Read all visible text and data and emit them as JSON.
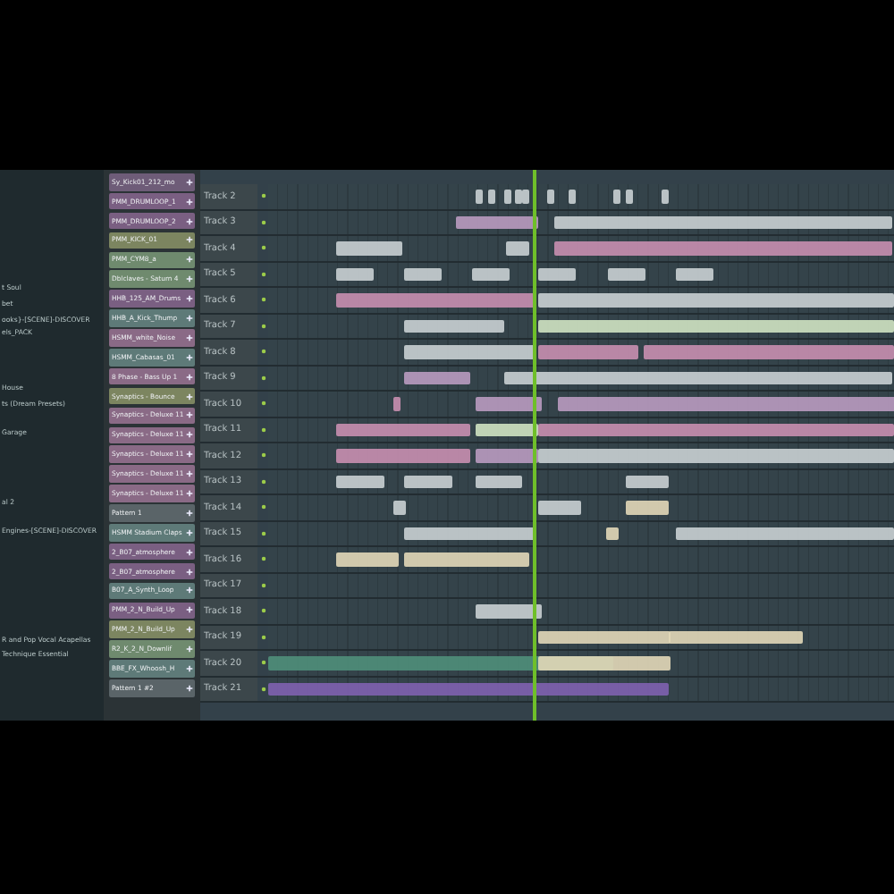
{
  "browser": {
    "items": [
      "t Soul",
      "bet",
      "ooks}-[SCENE]-DISCOVER",
      "els_PACK",
      "House",
      "ts (Dream Presets)",
      "Garage",
      "al 2",
      "Engines-[SCENE]-DISCOVER",
      "R and Pop Vocal Acapellas",
      "Technique Essential"
    ]
  },
  "channels": [
    {
      "name": "Sy_Kick01_212_mo",
      "color": "#6e5c78"
    },
    {
      "name": "PMM_DRUMLOOP_1",
      "color": "#7a5f82"
    },
    {
      "name": "PMM_DRUMLOOP_2",
      "color": "#7a5f82"
    },
    {
      "name": "PMM_KICK_01",
      "color": "#7c8560"
    },
    {
      "name": "PMM_CYM8_a",
      "color": "#6f8a6e"
    },
    {
      "name": "Dblclaves - Saturn 4",
      "color": "#6f8a6e"
    },
    {
      "name": "HHB_125_AM_Drums",
      "color": "#7a5f82"
    },
    {
      "name": "HHB_A_Kick_Thump",
      "color": "#5e7a78"
    },
    {
      "name": "HSMM_white_Noise",
      "color": "#8a6a86"
    },
    {
      "name": "HSMM_Cabasas_01",
      "color": "#5e7a78"
    },
    {
      "name": "8 Phase - Bass Up 1",
      "color": "#8a6a86"
    },
    {
      "name": "Synaptics - Bounce",
      "color": "#7c8560"
    },
    {
      "name": "Synaptics - Deluxe 11",
      "color": "#8a6a86"
    },
    {
      "name": "Synaptics - Deluxe 11",
      "color": "#8a6a86"
    },
    {
      "name": "Synaptics - Deluxe 11",
      "color": "#8a6a86"
    },
    {
      "name": "Synaptics - Deluxe 11",
      "color": "#8a6a86"
    },
    {
      "name": "Synaptics - Deluxe 11",
      "color": "#8a6a86"
    },
    {
      "name": "Pattern 1",
      "color": "#5a6468"
    },
    {
      "name": "HSMM Stadium Claps",
      "color": "#5e7a78"
    },
    {
      "name": "2_B07_atmosphere",
      "color": "#7a5f82"
    },
    {
      "name": "2_B07_atmosphere",
      "color": "#7a5f82"
    },
    {
      "name": "B07_A_Synth_Loop",
      "color": "#5e7a78"
    },
    {
      "name": "PMM_2_N_Build_Up",
      "color": "#7a5f82"
    },
    {
      "name": "PMM_2_N_Build_Up",
      "color": "#7c8560"
    },
    {
      "name": "R2_K_2_N_Downlif",
      "color": "#6f8a6e"
    },
    {
      "name": "BBE_FX_Whoosh_H",
      "color": "#5e7a78"
    },
    {
      "name": "Pattern 1 #2",
      "color": "#5a6468"
    }
  ],
  "tracks": [
    {
      "label": "Track 2"
    },
    {
      "label": "Track 3"
    },
    {
      "label": "Track 4"
    },
    {
      "label": "Track 5"
    },
    {
      "label": "Track 6"
    },
    {
      "label": "Track 7"
    },
    {
      "label": "Track 8"
    },
    {
      "label": "Track 9"
    },
    {
      "label": "Track 10"
    },
    {
      "label": "Track 11"
    },
    {
      "label": "Track 12"
    },
    {
      "label": "Track 13"
    },
    {
      "label": "Track 14"
    },
    {
      "label": "Track 15"
    },
    {
      "label": "Track 16"
    },
    {
      "label": "Track 17"
    },
    {
      "label": "Track 18"
    },
    {
      "label": "Track 19"
    },
    {
      "label": "Track 20"
    },
    {
      "label": "Track 21"
    }
  ]
}
